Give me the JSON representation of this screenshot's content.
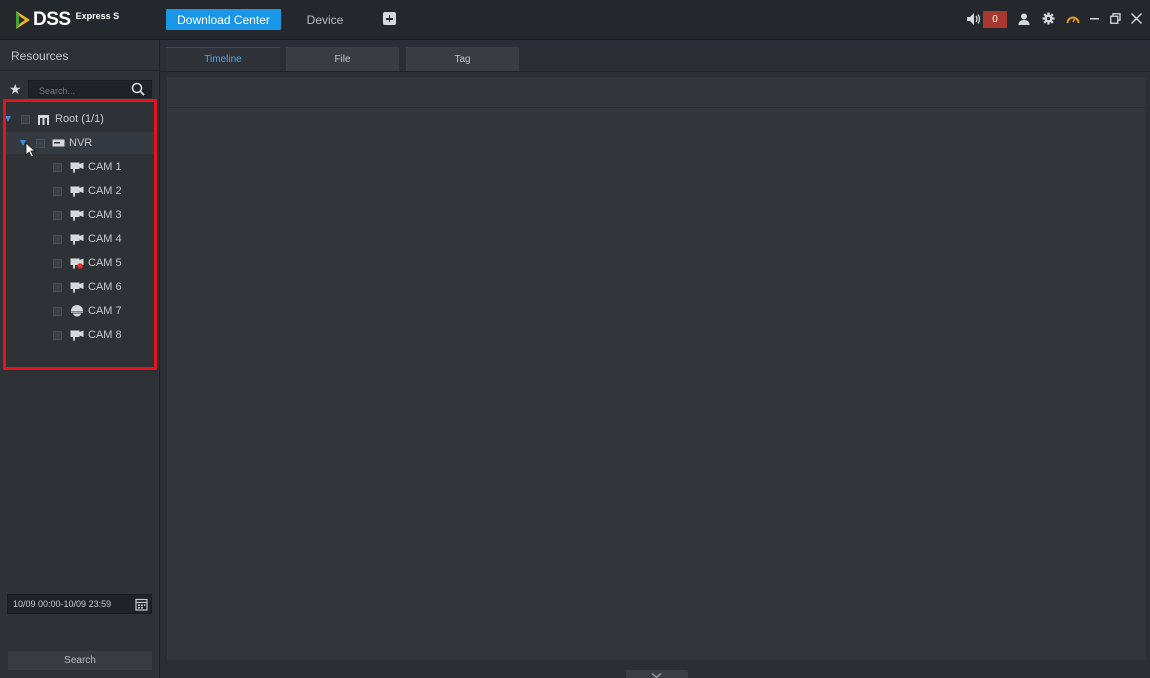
{
  "app": {
    "logo_text": "DSS",
    "logo_sub": "Express S",
    "tabs": [
      "Download Center",
      "Device"
    ],
    "alarm_count": "0"
  },
  "sidebar": {
    "title": "Resources",
    "search_placeholder": "Search...",
    "tree": {
      "root_label": "Root (1/1)",
      "nvr_label": "NVR",
      "cameras": [
        "CAM 1",
        "CAM 2",
        "CAM 3",
        "CAM 4",
        "CAM 5",
        "CAM 6",
        "CAM 7",
        "CAM 8"
      ]
    },
    "date_range": "10/09 00:00-10/09 23:59",
    "search_button": "Search"
  },
  "main": {
    "tabs": [
      "Timeline",
      "File",
      "Tag"
    ],
    "active_tab": "Timeline"
  },
  "colors": {
    "accent": "#1a96e6",
    "highlight_box": "#e3141b",
    "alarm_badge": "#a8382f",
    "active_tab_text": "#4ba6ef"
  }
}
